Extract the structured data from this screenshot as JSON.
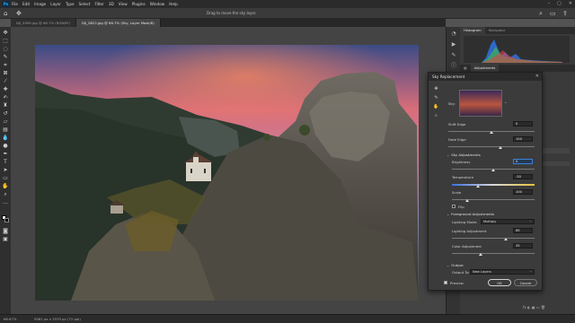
{
  "app": {
    "logo": "Ps"
  },
  "menu": [
    "File",
    "Edit",
    "Image",
    "Layer",
    "Type",
    "Select",
    "Filter",
    "3D",
    "View",
    "Plugins",
    "Window",
    "Help"
  ],
  "options_hint": "Drag to move the sky layer.",
  "tabs": [
    {
      "label": "DJI_0958.jpg @ 66.7% (RGB/8*)"
    },
    {
      "label": "DJI_0822.jpg @ 66.7% (Sky, Layer Mask/8)"
    }
  ],
  "right_panel": {
    "tab_histogram": "Histogram",
    "tab_navigator": "Navigator",
    "tab_adjustments": "Adjustments"
  },
  "status": {
    "zoom": "66.67%",
    "size": "5961 px x 3379 px (72 ppi)"
  },
  "dialog": {
    "title": "Sky Replacement",
    "sky_label": "Sky:",
    "shift_edge_label": "Shift Edge",
    "shift_edge_value": "0",
    "shift_edge_pos": 0.5,
    "fade_edge_label": "Fade Edge",
    "fade_edge_value": "100",
    "fade_edge_pos": 0.6,
    "sky_adjustments_label": "Sky Adjustments",
    "brightness_label": "Brightness",
    "brightness_value": "0",
    "brightness_pos": 0.5,
    "temperature_label": "Temperature",
    "temperature_value": "-30",
    "temperature_pos": 0.32,
    "scale_label": "Scale",
    "scale_value": "100",
    "scale_pos": 0.18,
    "flip_label": "Flip",
    "foreground_adjustments_label": "Foreground Adjustments",
    "lighting_mode_label": "Lighting Mode:",
    "lighting_mode_value": "Multiply",
    "lighting_adjustment_label": "Lighting Adjustment",
    "lighting_adjustment_value": "65",
    "lighting_adjustment_pos": 0.65,
    "color_adjustment_label": "Color Adjustment",
    "color_adjustment_value": "35",
    "color_adjustment_pos": 0.35,
    "output_label": "Output",
    "output_to_label": "Output To:",
    "output_to_value": "New Layers",
    "preview_label": "Preview",
    "ok_label": "OK",
    "cancel_label": "Cancel"
  },
  "colors": {
    "accent": "#3b80d8",
    "dialog_bg": "#3b3b3b",
    "app_bg": "#535353"
  }
}
